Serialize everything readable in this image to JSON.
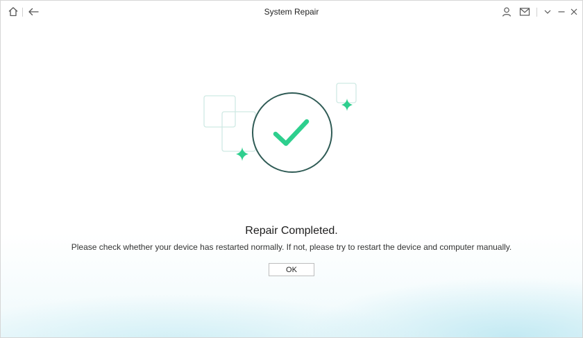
{
  "window": {
    "title": "System Repair"
  },
  "toolbar": {
    "home_icon": "home-icon",
    "back_icon": "back-arrow-icon",
    "account_icon": "user-icon",
    "mail_icon": "mail-icon",
    "dropdown_icon": "chevron-down-icon",
    "minimize_icon": "minimize-icon",
    "close_icon": "close-icon"
  },
  "main": {
    "heading": "Repair Completed.",
    "description": "Please check whether your device has restarted normally. If not, please try to restart the device and computer manually.",
    "ok_label": "OK"
  },
  "colors": {
    "accent_green": "#2ecf8e",
    "circle_stroke": "#2f5b55",
    "frame_stroke": "#cfe9e4"
  }
}
